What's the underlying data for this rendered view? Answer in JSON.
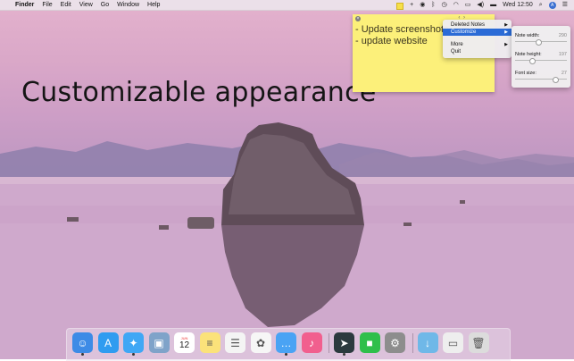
{
  "menubar": {
    "apple": "",
    "app": "Finder",
    "menus": [
      "File",
      "Edit",
      "View",
      "Go",
      "Window",
      "Help"
    ],
    "clock": "Wed 12:50"
  },
  "headline": "Customizable appearance",
  "note": {
    "lines": [
      "- Update screenshots",
      "- update website"
    ],
    "color": "#fcf07a"
  },
  "context_menu": {
    "items": [
      {
        "label": "Deleted Notes",
        "submenu": true
      },
      {
        "label": "Customize",
        "submenu": true,
        "selected": true
      },
      {
        "label": "More",
        "submenu": true
      },
      {
        "label": "Quit",
        "submenu": false
      }
    ]
  },
  "customize_panel": {
    "note_width": {
      "label": "Note width:",
      "value": "290",
      "fraction": 0.45
    },
    "note_height": {
      "label": "Note height:",
      "value": "197",
      "fraction": 0.32
    },
    "font_size": {
      "label": "Font size:",
      "value": "27",
      "fraction": 0.78
    }
  },
  "dock": {
    "apps": [
      {
        "name": "Finder",
        "icon": "finder-icon",
        "color": "#3d8be6",
        "running": true
      },
      {
        "name": "App Store",
        "icon": "app-store-icon",
        "color": "#2f9cf0",
        "running": false
      },
      {
        "name": "Safari",
        "icon": "safari-icon",
        "color": "#3fa7f5",
        "running": true
      },
      {
        "name": "Preview",
        "icon": "preview-icon",
        "color": "#7fa3c9",
        "running": false
      },
      {
        "name": "Calendar",
        "icon": "calendar-icon",
        "color": "#ffffff",
        "running": false,
        "text": "12",
        "month": "JUN"
      },
      {
        "name": "Notes",
        "icon": "notes-icon",
        "color": "#fbe27a",
        "running": false
      },
      {
        "name": "Reminders",
        "icon": "reminders-icon",
        "color": "#f4f4f4",
        "running": false
      },
      {
        "name": "Photos",
        "icon": "photos-icon",
        "color": "#f6f6f6",
        "running": false
      },
      {
        "name": "Messages",
        "icon": "messages-icon",
        "color": "#4aa3f4",
        "running": true
      },
      {
        "name": "iTunes",
        "icon": "itunes-icon",
        "color": "#f15f8e",
        "running": false
      },
      {
        "name": "Stickies App",
        "icon": "stickies-icon",
        "color": "#2b3a3e",
        "running": true
      },
      {
        "name": "FaceTime",
        "icon": "facetime-icon",
        "color": "#2fbf4b",
        "running": false
      },
      {
        "name": "System Preferences",
        "icon": "system-preferences-icon",
        "color": "#8d8d8d",
        "running": false
      },
      {
        "name": "Downloads",
        "icon": "downloads-icon",
        "color": "#6fb8e8",
        "running": false
      },
      {
        "name": "Screenshot",
        "icon": "screenshot-icon",
        "color": "#eeeeee",
        "running": false
      },
      {
        "name": "Trash",
        "icon": "trash-icon",
        "color": "#dcdcdc",
        "running": false
      }
    ]
  }
}
